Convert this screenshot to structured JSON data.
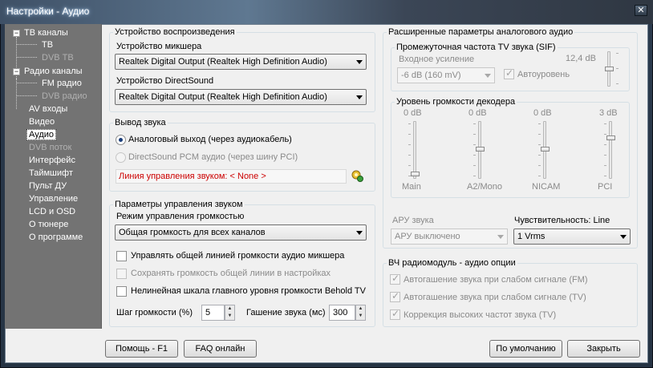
{
  "window": {
    "title": "Настройки - Аудио",
    "close_glyph": "✕"
  },
  "nav": {
    "items": [
      {
        "label": "ТВ каналы",
        "expander": "−"
      },
      {
        "label": "ТВ"
      },
      {
        "label": "DVB ТВ"
      },
      {
        "label": "Радио каналы",
        "expander": "−"
      },
      {
        "label": "FM радио"
      },
      {
        "label": "DVB радио"
      },
      {
        "label": "AV входы"
      },
      {
        "label": "Видео"
      },
      {
        "label": "Аудио"
      },
      {
        "label": "DVB поток"
      },
      {
        "label": "Интерфейс"
      },
      {
        "label": "Таймшифт"
      },
      {
        "label": "Пульт ДУ"
      },
      {
        "label": "Управление"
      },
      {
        "label": "LCD и OSD"
      },
      {
        "label": "О тюнере"
      },
      {
        "label": "О программе"
      }
    ]
  },
  "playback": {
    "title": "Устройство воспроизведения",
    "mixer_label": "Устройство микшера",
    "mixer_value": "Realtek Digital Output (Realtek High Definition Audio)",
    "ds_label": "Устройство DirectSound",
    "ds_value": "Realtek Digital Output (Realtek High Definition Audio)"
  },
  "output": {
    "title": "Вывод звука",
    "analog_label": "Аналоговый выход (через аудиокабель)",
    "directsound_label": "DirectSound PCM аудио (через шину PCI)",
    "line_label": "Линия управления звуком: < None >"
  },
  "volume": {
    "title": "Параметры управления звуком",
    "mode_label": "Режим управления громкостью",
    "mode_value": "Общая громкость для всех каналов",
    "cb1": "Управлять общей линией громкости аудио микшера",
    "cb2": "Сохранять громкость общей линии в настройках",
    "cb3": "Нелинейная шкала главного уровня громкости Behold TV",
    "step_label": "Шаг громкости (%)",
    "step_value": "5",
    "fade_label": "Гашение звука (мс)",
    "fade_value": "300"
  },
  "advanced": {
    "title": "Расширенные параметры аналогового аудио",
    "sif": {
      "title": "Промежуточная частота TV звука (SIF)",
      "gain_label": "Входное усиление",
      "gain_value": "-6 dB (160 mV)",
      "level": "12,4 dB",
      "auto_label": "Автоуровень",
      "slider_level": 0.5
    },
    "decoder": {
      "title": "Уровень громкости декодера",
      "channels": [
        {
          "name": "Main",
          "level": "0 dB",
          "slider_level": 0.02
        },
        {
          "name": "A2/Mono",
          "level": "0 dB",
          "slider_level": 0.5
        },
        {
          "name": "NICAM",
          "level": "0 dB",
          "slider_level": 0.5
        },
        {
          "name": "PCI",
          "level": "3 dB",
          "slider_level": 0.72
        }
      ]
    },
    "agc_label": "АРУ звука",
    "agc_value": "АРУ выключено",
    "sens_label": "Чувствительность: Line",
    "sens_value": "1 Vrms"
  },
  "rf": {
    "title": "ВЧ радиомодуль - аудио опции",
    "cb1": "Автогашение звука при слабом сигнале (FM)",
    "cb2": "Автогашение звука при слабом сигнале (TV)",
    "cb3": "Коррекция высоких частот звука (TV)"
  },
  "buttons": {
    "help": "Помощь - F1",
    "faq": "FAQ онлайн",
    "defaults": "По умолчанию",
    "close": "Закрыть"
  }
}
